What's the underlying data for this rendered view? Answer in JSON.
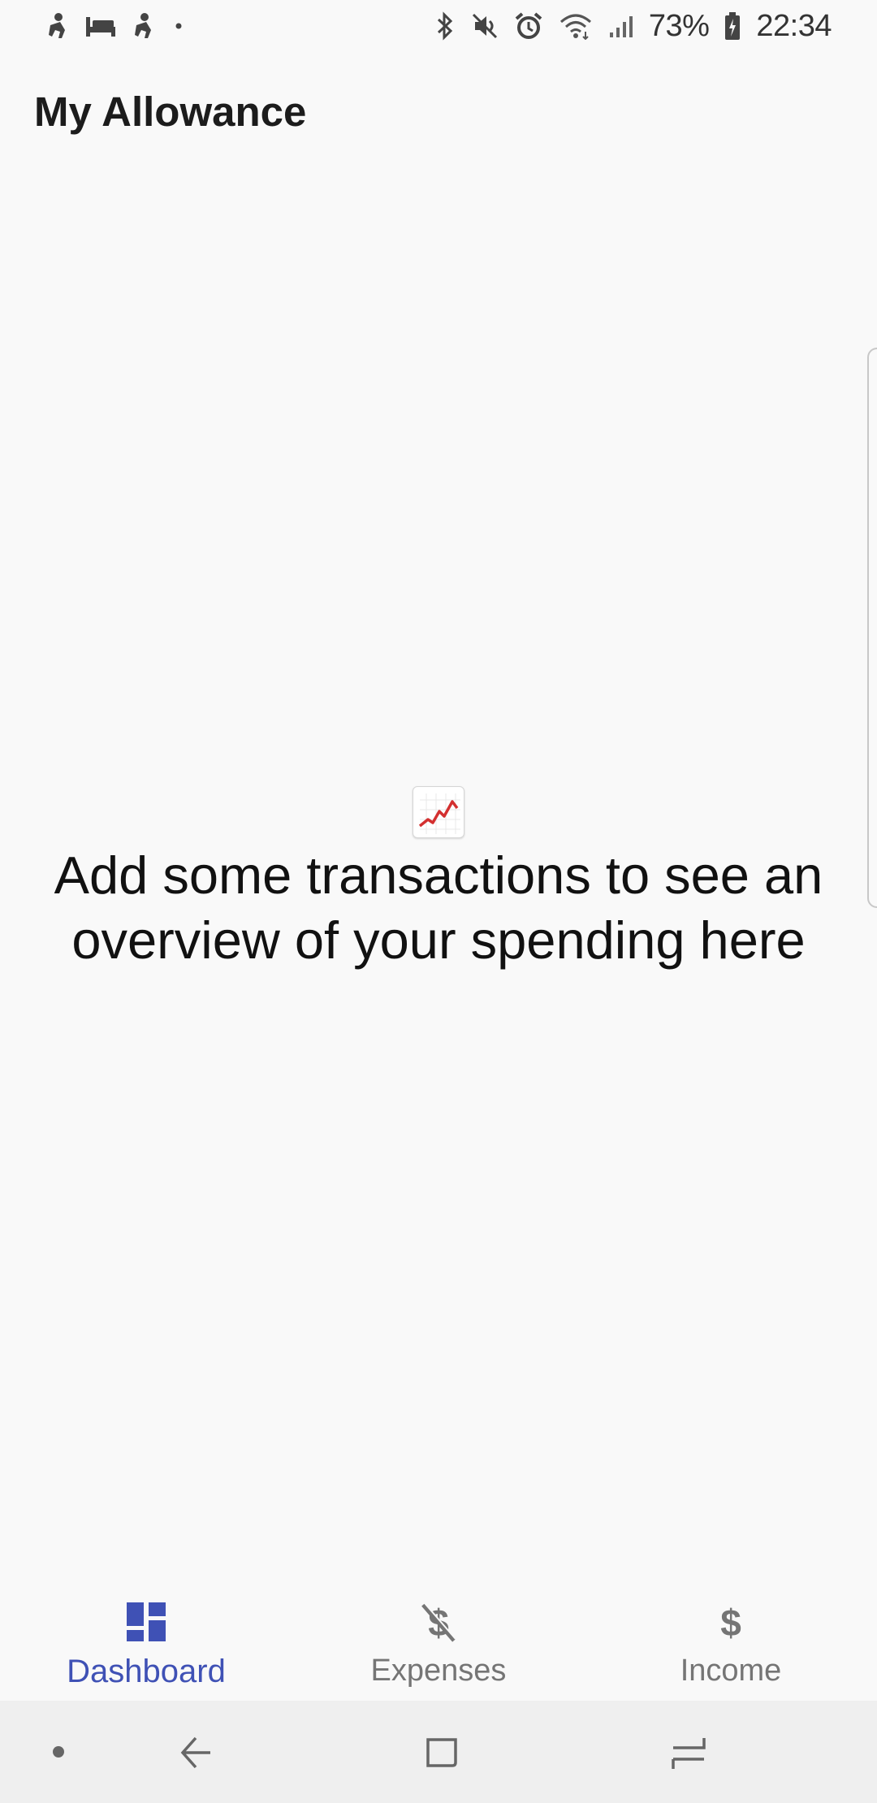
{
  "status_bar": {
    "battery_percent": "73%",
    "time": "22:34",
    "icons_left": [
      "notification-icon",
      "bed-icon",
      "notification-icon",
      "dot-icon"
    ],
    "icons_right": [
      "bluetooth-icon",
      "mute-icon",
      "alarm-icon",
      "wifi-icon",
      "signal-icon",
      "battery-icon"
    ]
  },
  "app_bar": {
    "title": "My Allowance"
  },
  "empty_state": {
    "icon": "chart-increasing-icon",
    "message": "Add some transactions to see an overview of your spending here"
  },
  "bottom_nav": {
    "items": [
      {
        "label": "Dashboard",
        "icon": "dashboard-icon",
        "active": true
      },
      {
        "label": "Expenses",
        "icon": "money-off-icon",
        "active": false
      },
      {
        "label": "Income",
        "icon": "dollar-icon",
        "active": false
      }
    ]
  },
  "system_nav": {
    "buttons": [
      "dot-button",
      "back-button",
      "home-button",
      "recents-button"
    ]
  },
  "colors": {
    "accent": "#3f51b5",
    "inactive": "#757575",
    "background": "#f9f9f9",
    "system_nav_bg": "#efefef"
  }
}
